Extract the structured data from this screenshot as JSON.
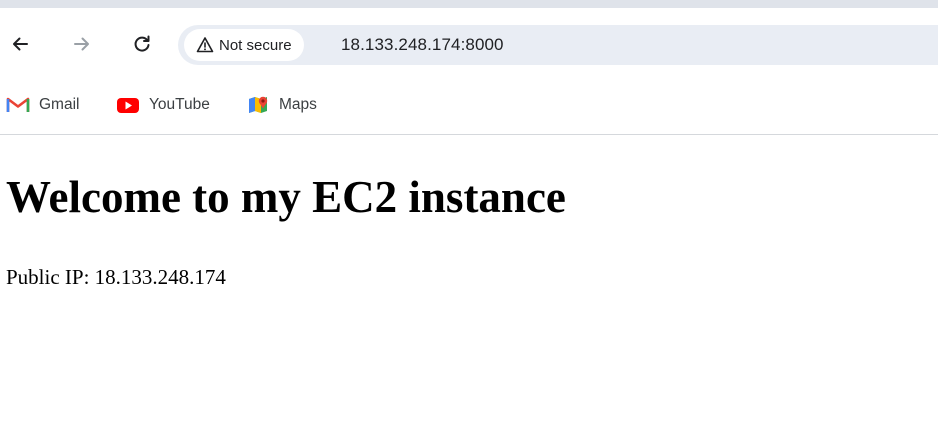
{
  "browser": {
    "nav": {
      "back_icon": "arrow-left-icon",
      "forward_icon": "arrow-right-icon",
      "reload_icon": "reload-icon"
    },
    "omnibox": {
      "security_label": "Not secure",
      "security_icon": "warning-triangle-icon",
      "url": "18.133.248.174:8000"
    },
    "bookmarks": [
      {
        "label": "Gmail",
        "icon": "gmail-icon"
      },
      {
        "label": "YouTube",
        "icon": "youtube-icon"
      },
      {
        "label": "Maps",
        "icon": "maps-icon"
      }
    ],
    "colors": {
      "top_strip": "#dfe3ea",
      "omnibox_bg": "#e9edf4",
      "gmail_red": "#ea4335",
      "youtube_red": "#ff0000"
    }
  },
  "page": {
    "heading": "Welcome to my EC2 instance",
    "public_ip_text": "Public IP: 18.133.248.174"
  }
}
